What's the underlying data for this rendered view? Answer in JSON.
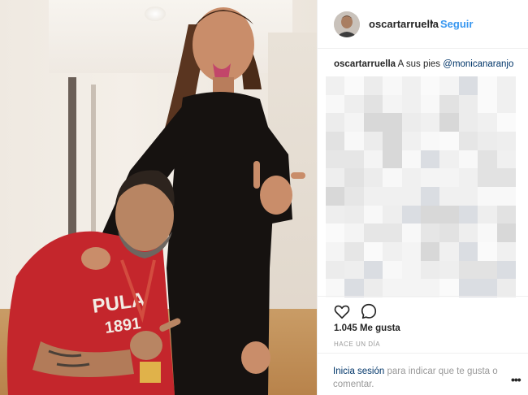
{
  "post": {
    "photo_alt": "",
    "header": {
      "username": "oscartarruella",
      "separator": "•",
      "follow_label": "Seguir",
      "avatar_icon": "user-avatar"
    },
    "caption": {
      "author": "oscartarruella",
      "text": "A sus pies",
      "mention": "@monicanaranjo"
    },
    "comments_blurred": true,
    "actions": {
      "like_icon": "heart-outline-icon",
      "comment_icon": "speech-bubble-icon"
    },
    "likes": "1.045 Me gusta",
    "timestamp": "HACE UN DÍA",
    "login_prompt": {
      "link": "Inicia sesión",
      "text": " para indicar que te gusta o comentar."
    },
    "more_icon": "ellipsis-icon",
    "colors": {
      "link_blue": "#3897f0",
      "mention_blue": "#003569",
      "border": "#efefef",
      "muted": "#999999"
    }
  }
}
